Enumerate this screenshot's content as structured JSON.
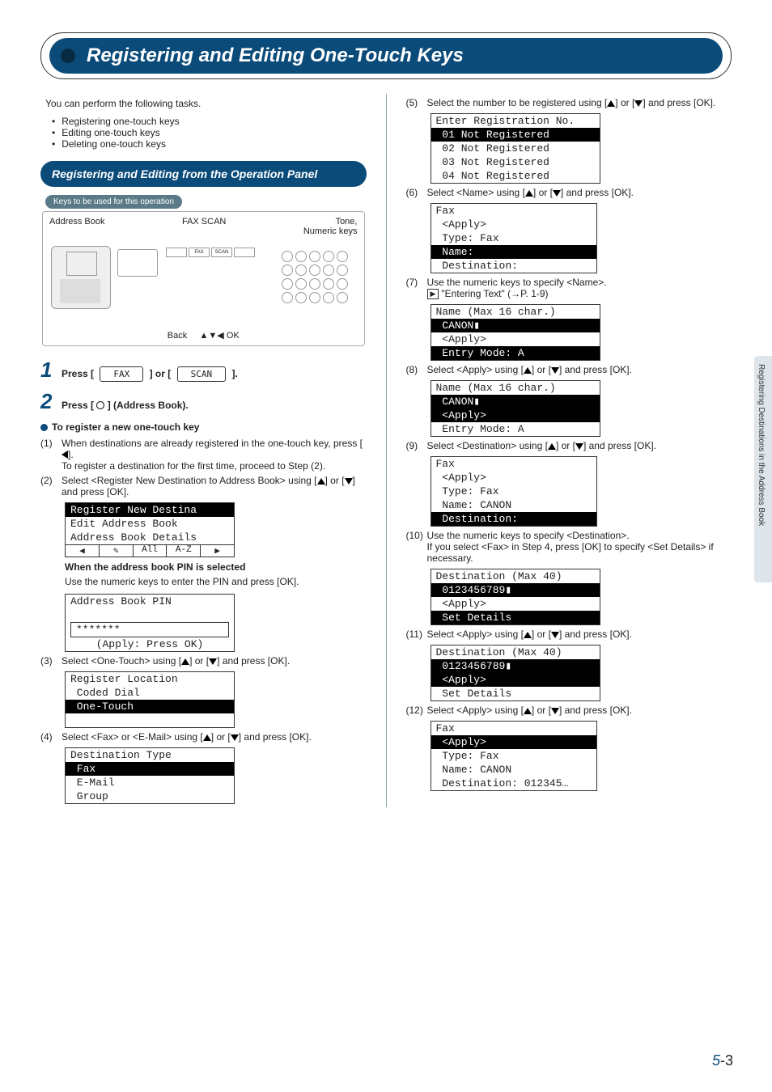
{
  "title": "Registering and Editing One-Touch Keys",
  "intro": "You can perform the following tasks.",
  "tasks": [
    "Registering one-touch keys",
    "Editing one-touch keys",
    "Deleting one-touch keys"
  ],
  "section1": "Registering and Editing from the Operation Panel",
  "keys_label": "Keys to be used for this operation",
  "panel_labels": {
    "addr": "Address Book",
    "faxscan": "FAX  SCAN",
    "tone": "Tone,\nNumeric keys",
    "back": "Back",
    "ok": "▲▼◀ OK",
    "fax_btn": "FAX",
    "scan_btn": "SCAN"
  },
  "step1": {
    "pre": "Press [",
    "fax": "FAX",
    "mid": "] or [",
    "scan": "SCAN",
    "post": "]."
  },
  "step2": "Press [      ] (Address Book).",
  "reg_head": "To register a new one-touch key",
  "sub1": {
    "n": "(1)",
    "l1": "When destinations are already registered in the one-touch key, press [    ].",
    "l2": "To register a destination for the first time, proceed to Step (2)."
  },
  "sub2": {
    "n": "(2)",
    "t": "Select <Register New Destination to Address Book> using [    ] or [    ] and press [OK]."
  },
  "lcd_a": {
    "l1": "Register New Destina",
    "l2": "Edit Address Book",
    "l3": "Address Book Details",
    "tabs": [
      "◀",
      "✎",
      "All",
      "A-Z",
      "▶"
    ]
  },
  "pin_head": "When the address book PIN is selected",
  "pin_text": "Use the numeric keys to enter the PIN and press [OK].",
  "lcd_pin": {
    "l1": "Address Book PIN",
    "l2": "*******",
    "l3": "(Apply: Press OK)"
  },
  "sub3": {
    "n": "(3)",
    "t": "Select <One-Touch> using [    ] or [    ] and press [OK]."
  },
  "lcd_b": {
    "l1": "Register Location",
    "l2": " Coded Dial",
    "l3": " One-Touch"
  },
  "sub4": {
    "n": "(4)",
    "t": "Select <Fax> or <E-Mail> using [    ] or [    ] and press [OK]."
  },
  "lcd_c": {
    "l1": "Destination Type",
    "l2": " Fax",
    "l3": " E-Mail",
    "l4": " Group"
  },
  "sub5": {
    "n": "(5)",
    "t": "Select the number to be registered using [    ] or [    ] and press [OK]."
  },
  "lcd_d": {
    "l1": "Enter Registration No.",
    "l2": " 01 Not Registered",
    "l3": " 02 Not Registered",
    "l4": " 03 Not Registered",
    "l5": " 04 Not Registered"
  },
  "sub6": {
    "n": "(6)",
    "t": "Select <Name> using [    ] or [    ] and press [OK]."
  },
  "lcd_e": {
    "l1": "Fax",
    "l2": " <Apply>",
    "l3": " Type: Fax",
    "l4": " Name:",
    "l5": " Destination:"
  },
  "sub7": {
    "n": "(7)",
    "l1": "Use the numeric keys to specify <Name>.",
    "l2": "\"Entering Text\" (→P. 1-9)"
  },
  "lcd_f": {
    "l1": "Name (Max 16 char.)",
    "l2": " CANON▮",
    "l3": " <Apply>",
    "l4": " Entry Mode: A"
  },
  "sub8": {
    "n": "(8)",
    "t": "Select <Apply> using [    ] or [    ] and press [OK]."
  },
  "lcd_g": {
    "l1": "Name (Max 16 char.)",
    "l2": " CANON▮",
    "l3": " <Apply>",
    "l4": " Entry Mode: A"
  },
  "sub9": {
    "n": "(9)",
    "t": "Select <Destination> using [    ] or [    ] and press [OK]."
  },
  "lcd_h": {
    "l1": "Fax",
    "l2": " <Apply>",
    "l3": " Type: Fax",
    "l4": " Name: CANON",
    "l5": " Destination:"
  },
  "sub10": {
    "n": "(10)",
    "l1": "Use the numeric keys to specify <Destination>.",
    "l2": "If you select <Fax> in Step 4, press [OK] to specify <Set Details> if necessary."
  },
  "lcd_i": {
    "l1": "Destination (Max 40)",
    "l2": " 0123456789▮",
    "l3": " <Apply>",
    "l4": " Set Details"
  },
  "sub11": {
    "n": "(11)",
    "t": "Select <Apply> using [    ] or [    ] and press [OK]."
  },
  "lcd_j": {
    "l1": "Destination (Max 40)",
    "l2": " 0123456789▮",
    "l3": " <Apply>",
    "l4": " Set Details"
  },
  "sub12": {
    "n": "(12)",
    "t": "Select <Apply> using [    ] or [    ] and press [OK]."
  },
  "lcd_k": {
    "l1": "Fax",
    "l2": " <Apply>",
    "l3": " Type: Fax",
    "l4": " Name: CANON",
    "l5": " Destination: 012345…"
  },
  "side_tab": "Registering Destinations in the Address Book",
  "page_chapter": "5",
  "page_num": "-3"
}
